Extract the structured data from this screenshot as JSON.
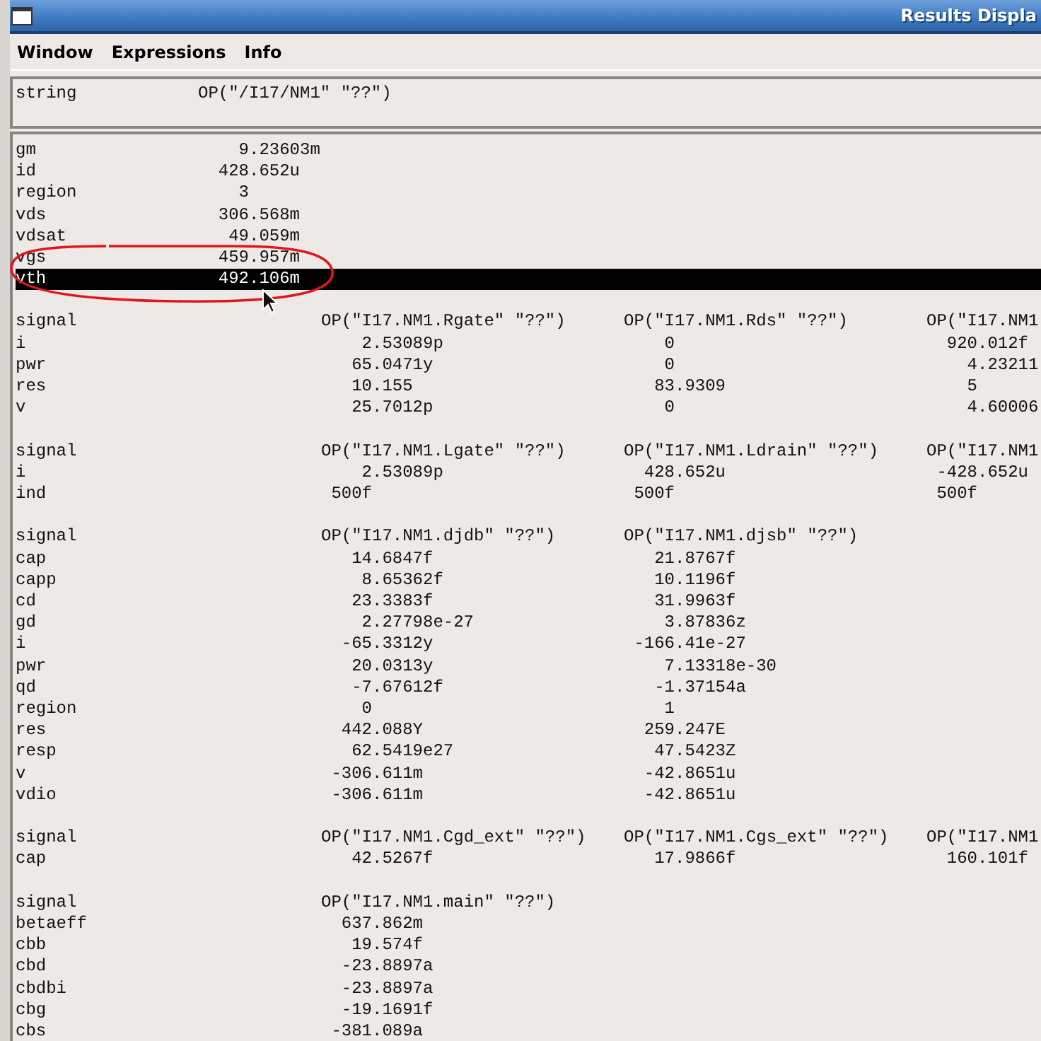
{
  "window": {
    "title": "Results Displa"
  },
  "menu": [
    "Window",
    "Expressions",
    "Info"
  ],
  "string_panel": {
    "label": "string",
    "value": "OP(\"/I17/NM1\" \"??\")"
  },
  "summary": [
    {
      "name": "gm",
      "value": "9.23603m",
      "selected": false
    },
    {
      "name": "id",
      "value": "428.652u",
      "selected": false
    },
    {
      "name": "region",
      "value": "3",
      "selected": false
    },
    {
      "name": "vds",
      "value": "306.568m",
      "selected": false
    },
    {
      "name": "vdsat",
      "value": "49.059m",
      "selected": false
    },
    {
      "name": "vgs",
      "value": "459.957m",
      "selected": false
    },
    {
      "name": "vth",
      "value": "492.106m",
      "selected": true
    }
  ],
  "groups": [
    {
      "columns": [
        "signal",
        "OP(\"I17.NM1.Rgate\" \"??\")",
        "OP(\"I17.NM1.Rds\" \"??\")",
        "OP(\"I17.NM1"
      ],
      "rows": [
        [
          "i",
          "2.53089p",
          "0",
          "920.012f"
        ],
        [
          "pwr",
          "65.0471y",
          "0",
          "4.23211"
        ],
        [
          "res",
          "10.155",
          "83.9309",
          "5"
        ],
        [
          "v",
          "25.7012p",
          "0",
          "4.60006"
        ]
      ]
    },
    {
      "columns": [
        "signal",
        "OP(\"I17.NM1.Lgate\" \"??\")",
        "OP(\"I17.NM1.Ldrain\" \"??\")",
        "OP(\"I17.NM1"
      ],
      "rows": [
        [
          "i",
          "2.53089p",
          "428.652u",
          "-428.652u"
        ],
        [
          "ind",
          "500f",
          "500f",
          "500f"
        ]
      ]
    },
    {
      "columns": [
        "signal",
        "OP(\"I17.NM1.djdb\" \"??\")",
        "OP(\"I17.NM1.djsb\" \"??\")"
      ],
      "rows": [
        [
          "cap",
          "14.6847f",
          "21.8767f"
        ],
        [
          "capp",
          "8.65362f",
          "10.1196f"
        ],
        [
          "cd",
          "23.3383f",
          "31.9963f"
        ],
        [
          "gd",
          "2.27798e-27",
          "3.87836z"
        ],
        [
          "i",
          "-65.3312y",
          "-166.41e-27"
        ],
        [
          "pwr",
          "20.0313y",
          "7.13318e-30"
        ],
        [
          "qd",
          "-7.67612f",
          "-1.37154a"
        ],
        [
          "region",
          "0",
          "1"
        ],
        [
          "res",
          "442.088Y",
          "259.247E"
        ],
        [
          "resp",
          "62.5419e27",
          "47.5423Z"
        ],
        [
          "v",
          "-306.611m",
          "-42.8651u"
        ],
        [
          "vdio",
          "-306.611m",
          "-42.8651u"
        ]
      ]
    },
    {
      "columns": [
        "signal",
        "OP(\"I17.NM1.Cgd_ext\" \"??\")",
        "OP(\"I17.NM1.Cgs_ext\" \"??\")",
        "OP(\"I17.NM1"
      ],
      "rows": [
        [
          "cap",
          "42.5267f",
          "17.9866f",
          "160.101f"
        ]
      ]
    },
    {
      "columns": [
        "signal",
        "OP(\"I17.NM1.main\" \"??\")"
      ],
      "rows": [
        [
          "betaeff",
          "637.862m"
        ],
        [
          "cbb",
          "19.574f"
        ],
        [
          "cbd",
          "-23.8897a"
        ],
        [
          "cbdbi",
          "-23.8897a"
        ],
        [
          "cbg",
          "-19.1691f"
        ],
        [
          "cbs",
          "-381.089a"
        ]
      ]
    }
  ]
}
